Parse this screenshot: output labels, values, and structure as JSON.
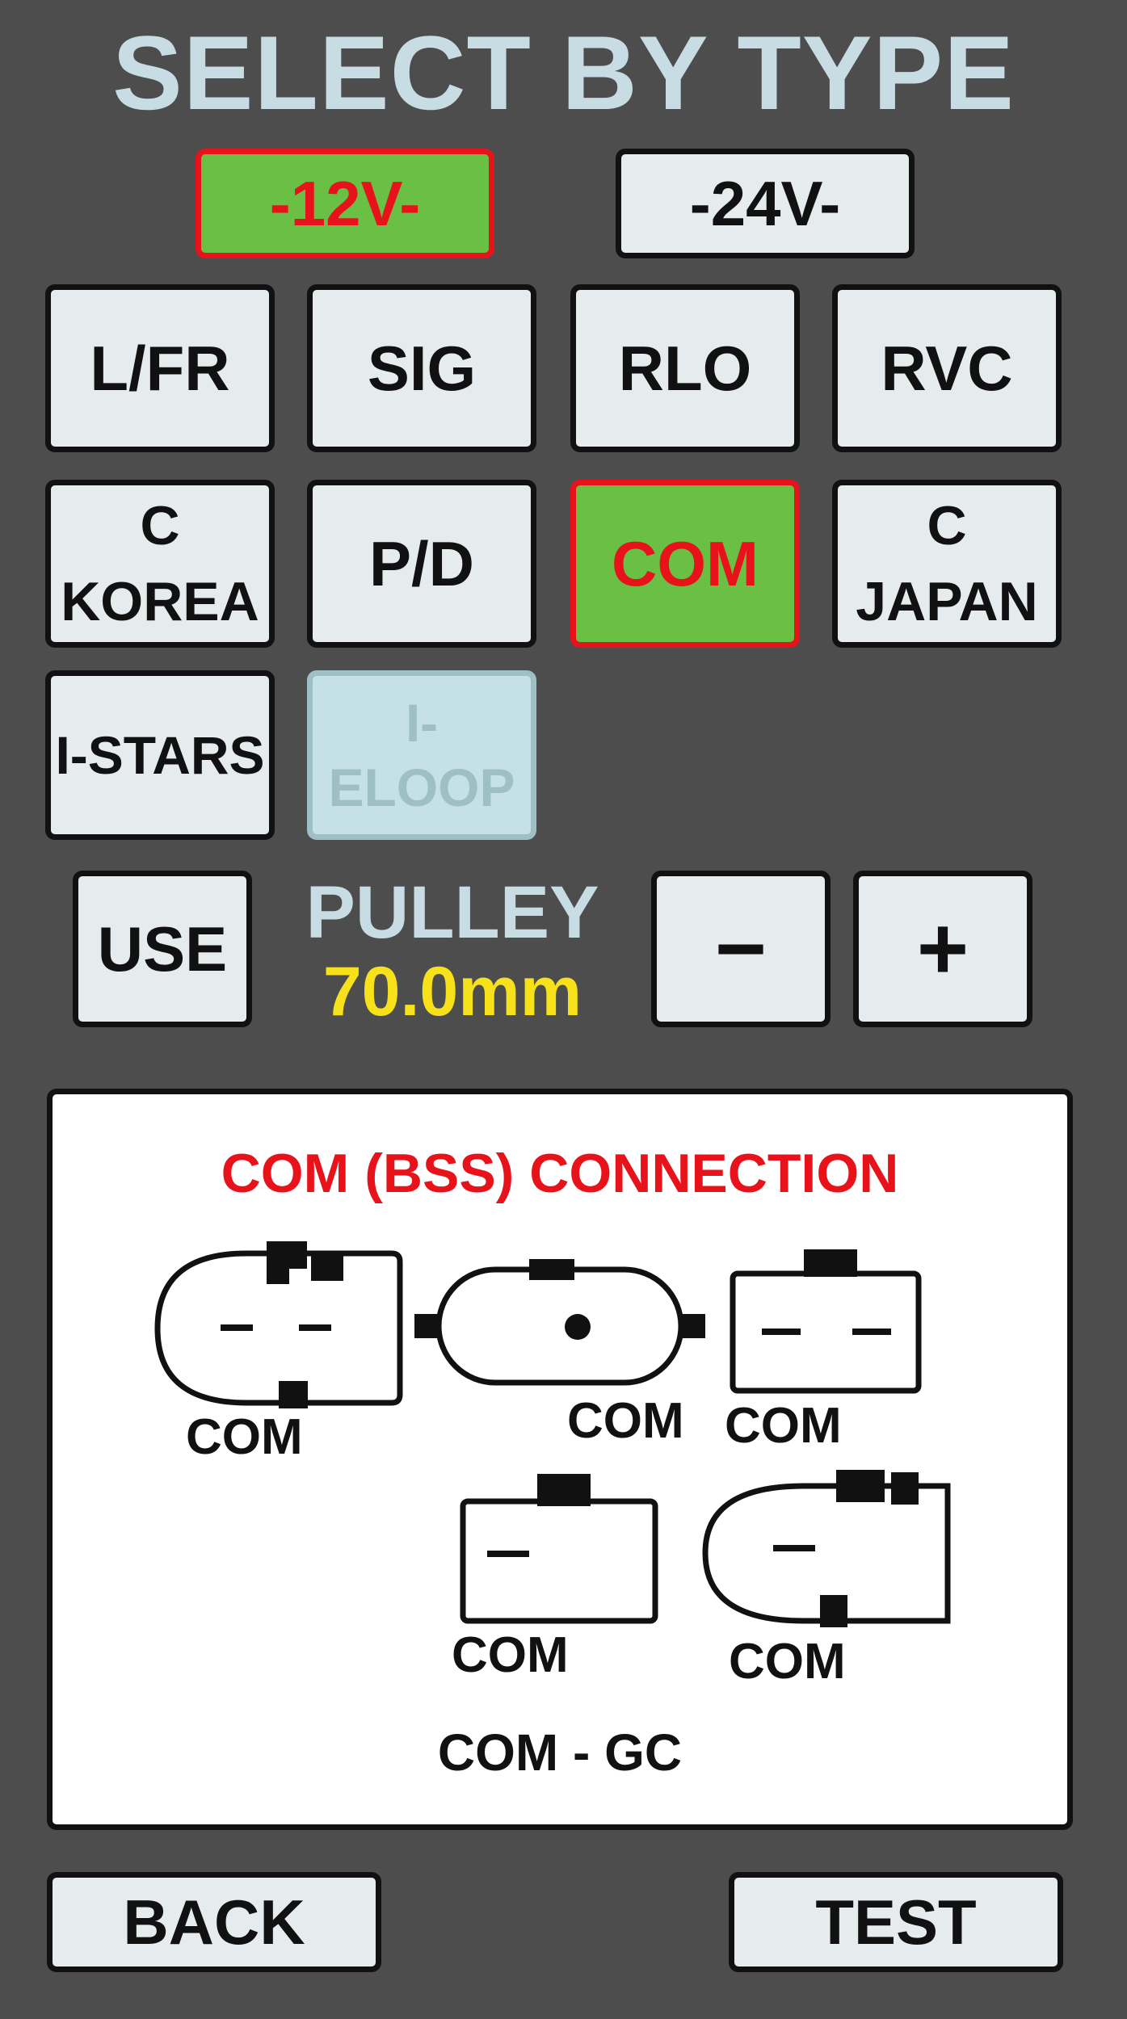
{
  "header": {
    "title": "SELECT BY TYPE"
  },
  "voltage": {
    "v12": "-12V-",
    "v24": "-24V-",
    "selected": "-12V-"
  },
  "types": {
    "lfr": "L/FR",
    "sig": "SIG",
    "rlo": "RLO",
    "rvc": "RVC",
    "ckorea": "C\nKOREA",
    "pd": "P/D",
    "com": "COM",
    "cjapan": "C\nJAPAN",
    "istars": "I-STARS",
    "ieloop": "I-ELOOP",
    "selected": "COM",
    "disabled": "I-ELOOP"
  },
  "pulley": {
    "use_label": "USE",
    "label": "PULLEY",
    "value": "70.0mm",
    "minus": "−",
    "plus": "+"
  },
  "connection": {
    "title": "COM (BSS) CONNECTION",
    "labels": [
      "COM",
      "COM",
      "COM",
      "COM",
      "COM"
    ],
    "caption": "COM - GC"
  },
  "footer": {
    "back": "BACK",
    "test": "TEST"
  },
  "colors": {
    "background": "#4d4d4d",
    "button": "#e6ecee",
    "selected_fill": "#6abf45",
    "selected_text": "#e8121a",
    "title": "#c8dce3",
    "pulley_value": "#f7e11b",
    "disabled": "#c5e0e6"
  }
}
